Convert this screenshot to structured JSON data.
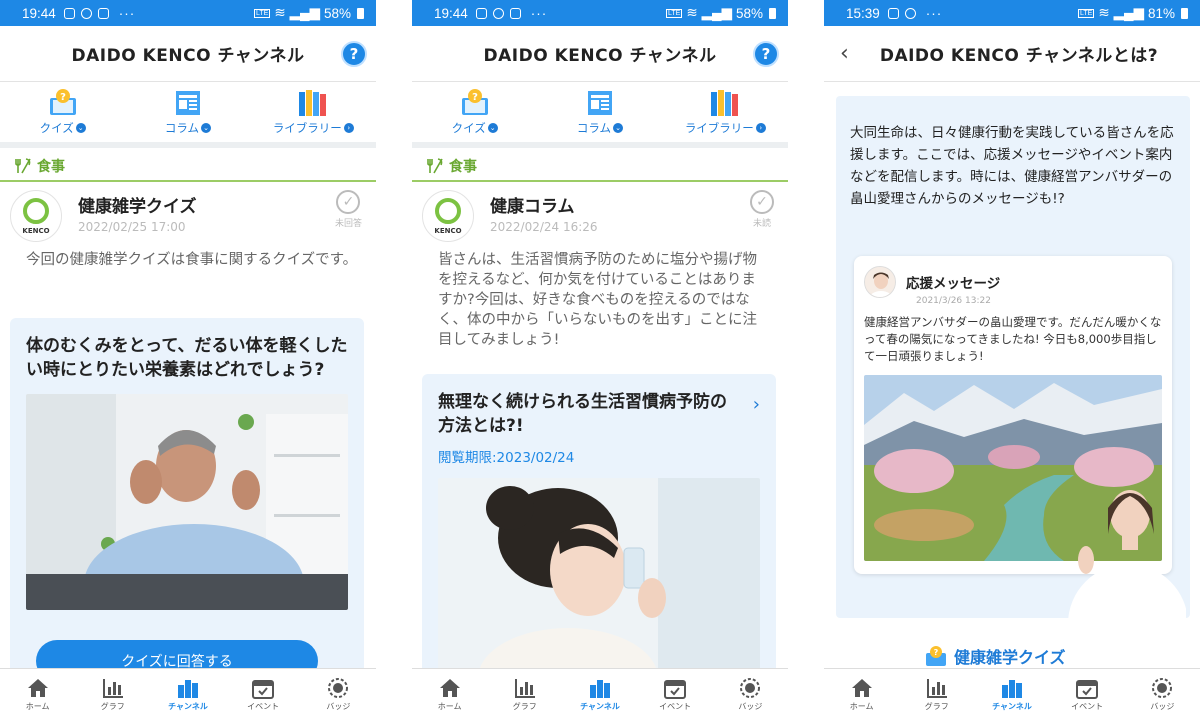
{
  "bottom_nav": [
    {
      "label": "ホーム",
      "icon": "home-icon"
    },
    {
      "label": "グラフ",
      "icon": "graph-icon"
    },
    {
      "label": "チャンネル",
      "icon": "channel-icon",
      "active": true
    },
    {
      "label": "イベント",
      "icon": "calendar-icon"
    },
    {
      "label": "バッジ",
      "icon": "badge-icon"
    }
  ],
  "top_nav": [
    {
      "label": "クイズ",
      "icon": "quiz-book-icon"
    },
    {
      "label": "コラム",
      "icon": "column-doc-icon"
    },
    {
      "label": "ライブラリー",
      "icon": "library-books-icon"
    }
  ],
  "colors": {
    "primary": "#1e88e5",
    "green": "#7cc242",
    "card_bg": "#eaf3fc"
  },
  "screens": [
    {
      "status": {
        "time": "19:44",
        "battery": "58%"
      },
      "header": {
        "title": "DAIDO KENCO チャンネル",
        "help": "?"
      },
      "category": "食事",
      "post": {
        "logo_text": "KENCO",
        "title": "健康雑学クイズ",
        "date": "2022/02/25 17:00",
        "status": "未回答",
        "body": "今回の健康雑学クイズは食事に関するクイズです。"
      },
      "card": {
        "title": "体のむくみをとって、だるい体を軽くしたい時にとりたい栄養素はどれでしょう?",
        "button": "クイズに回答する"
      }
    },
    {
      "status": {
        "time": "19:44",
        "battery": "58%"
      },
      "header": {
        "title": "DAIDO KENCO チャンネル",
        "help": "?"
      },
      "category": "食事",
      "post": {
        "logo_text": "KENCO",
        "title": "健康コラム",
        "date": "2022/02/24 16:26",
        "status": "未読",
        "body": "皆さんは、生活習慣病予防のために塩分や揚げ物を控えるなど、何か気を付けていることはありますか?今回は、好きな食べものを控えるのではなく、体の中から「いらないものを出す」ことに注目してみましょう!"
      },
      "card": {
        "title": "無理なく続けられる生活習慣病予防の方法とは?!",
        "deadline": "閲覧期限:2023/02/24"
      }
    },
    {
      "status": {
        "time": "15:39",
        "battery": "81%"
      },
      "header": {
        "title": "DAIDO KENCO チャンネルとは?"
      },
      "intro": "大同生命は、日々健康行動を実践している皆さんを応援します。ここでは、応援メッセージやイベント案内などを配信します。時には、健康経営アンバサダーの畠山愛理さんからのメッセージも!?",
      "message": {
        "title": "応援メッセージ",
        "date": "2021/3/26 13:22",
        "body": "健康経営アンバサダーの畠山愛理です。だんだん暖かくなって春の陽気になってきましたね! 今日も8,000歩目指して一日頑張りましょう!"
      },
      "quiz_link": "健康雑学クイズ"
    }
  ]
}
